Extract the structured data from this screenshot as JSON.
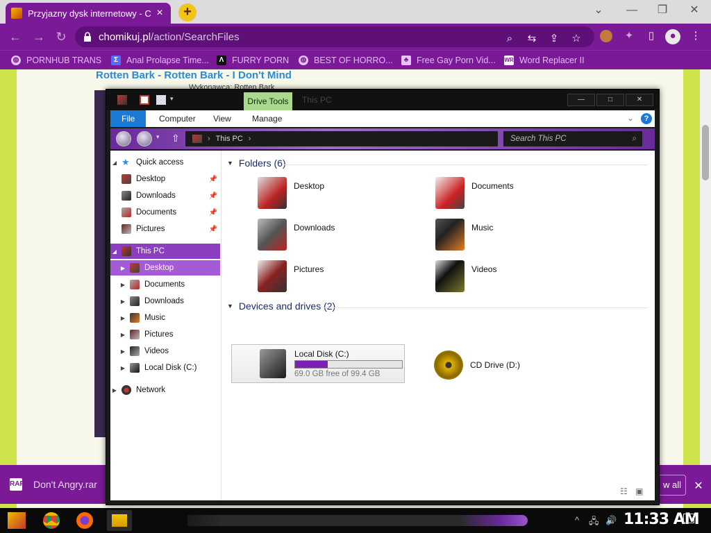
{
  "browser": {
    "tab_title": "Przyjazny dysk internetowy - C",
    "url_domain": "chomikuj.pl",
    "url_path": "/action/SearchFiles",
    "accent_color": "#7b1a96",
    "bookmarks": [
      {
        "label": "PORNHUB TRANS",
        "icon": "globe-icon"
      },
      {
        "label": "Anal Prolapse Time...",
        "icon": "bookmark-icon"
      },
      {
        "label": "FURRY PORN",
        "icon": "lambda-icon"
      },
      {
        "label": "BEST OF HORRO...",
        "icon": "globe-icon"
      },
      {
        "label": "Free Gay Porn Vid...",
        "icon": "bookmark-icon"
      },
      {
        "label": "Word Replacer II",
        "icon": "extension-icon"
      }
    ]
  },
  "page": {
    "heading": "Rotten Bark - Rotten Bark - I Don't Mind",
    "sub": "Wykonawca: Rotten Bark"
  },
  "download": {
    "filename": "Don't Angry.rar",
    "show_all": "w all"
  },
  "explorer": {
    "drive_tools": "Drive Tools",
    "window_title": "This PC",
    "ribbon_tabs": [
      "File",
      "Computer",
      "View",
      "Manage"
    ],
    "address": "This PC",
    "search_placeholder": "Search This PC",
    "nav": {
      "quick_access": "Quick access",
      "quick_items": [
        "Desktop",
        "Downloads",
        "Documents",
        "Pictures"
      ],
      "this_pc": "This PC",
      "pc_items": [
        "Desktop",
        "Documents",
        "Downloads",
        "Music",
        "Pictures",
        "Videos",
        "Local Disk (C:)"
      ],
      "network": "Network"
    },
    "folders_header": "Folders (6)",
    "folders": [
      "Desktop",
      "Documents",
      "Downloads",
      "Music",
      "Pictures",
      "Videos"
    ],
    "devices_header": "Devices and drives (2)",
    "local_disk": {
      "name": "Local Disk (C:)",
      "free_text": "69.0 GB free of 99.4 GB",
      "used_fraction": 0.306
    },
    "cd_drive": "CD Drive (D:)"
  },
  "taskbar": {
    "clock": "11:33 AM"
  }
}
